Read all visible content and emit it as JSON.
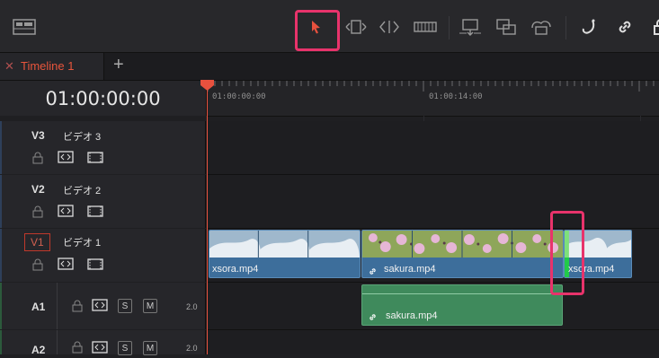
{
  "timeline": {
    "tab_label": "Timeline 1",
    "tab_close": "✕",
    "tab_add": "+",
    "timecode": "01:00:00:00",
    "ruler_labels": [
      "01:00:00:00",
      "01:00:14:00"
    ]
  },
  "tracks": {
    "v3": {
      "id": "V3",
      "name": "ビデオ 3"
    },
    "v2": {
      "id": "V2",
      "name": "ビデオ 2"
    },
    "v1": {
      "id": "V1",
      "name": "ビデオ 1"
    },
    "a1": {
      "id": "A1",
      "solo": "S",
      "mute": "M",
      "channels": "2.0"
    },
    "a2": {
      "id": "A2",
      "solo": "S",
      "mute": "M",
      "channels": "2.0"
    }
  },
  "clips": {
    "v1_first": "xsora.mp4",
    "v1_second": "sakura.mp4",
    "v1_third": "xsora.mp4",
    "a1_first": "sakura.mp4"
  },
  "icons": {
    "toolbar": [
      "layout-icon",
      "selection-pointer-icon",
      "trim-edit-icon",
      "dynamic-trim-icon",
      "blade-icon",
      "overwrite-icon",
      "replace-icon",
      "place-on-top-icon",
      "snapping-icon",
      "link-icon"
    ],
    "track": [
      "lock-icon",
      "auto-select-icon",
      "track-enable-icon"
    ]
  },
  "colors": {
    "accent": "#e8336b",
    "playhead": "#e8513e",
    "video_clip": "#3d6e9b",
    "audio_clip": "#3f8a5c"
  }
}
